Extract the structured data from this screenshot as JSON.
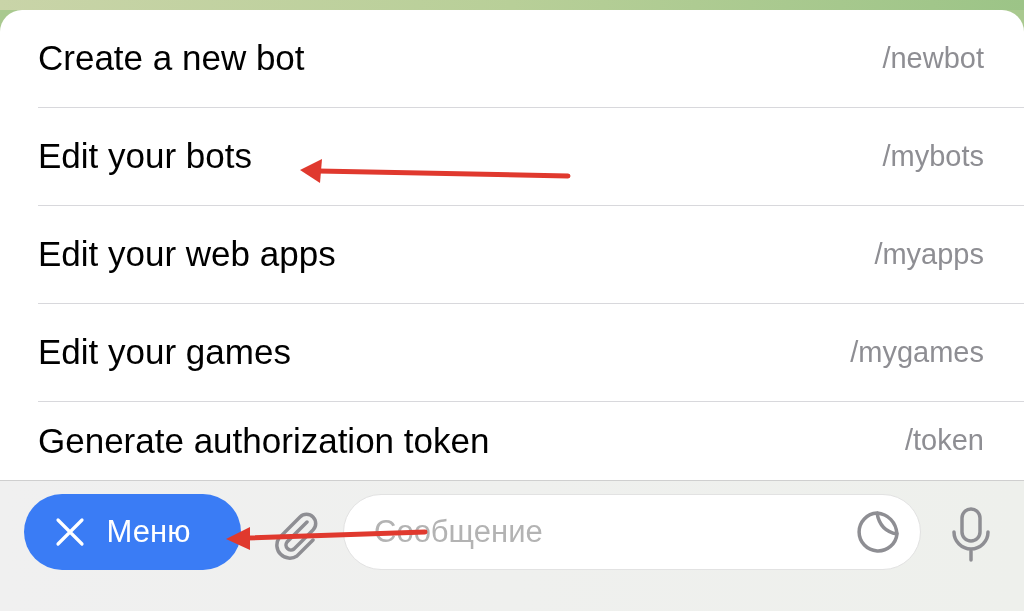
{
  "commands": [
    {
      "label": "Create a new bot",
      "command": "/newbot"
    },
    {
      "label": "Edit your bots",
      "command": "/mybots"
    },
    {
      "label": "Edit your web apps",
      "command": "/myapps"
    },
    {
      "label": "Edit your games",
      "command": "/mygames"
    },
    {
      "label": "Generate authorization token",
      "command": "/token"
    }
  ],
  "menu_button": {
    "label": "Меню"
  },
  "message_field": {
    "placeholder": "Сообщение"
  }
}
